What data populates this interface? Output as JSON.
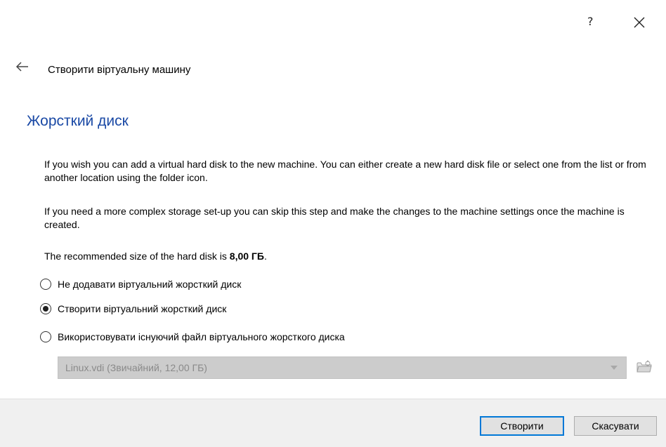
{
  "titlebar": {
    "help_label": "?",
    "close_icon": "close-icon"
  },
  "header": {
    "back_icon": "arrow-left-icon",
    "title": "Створити віртуальну машину"
  },
  "section": {
    "title": "Жорсткий диск"
  },
  "paragraphs": {
    "p1": "If you wish you can add a virtual hard disk to the new machine. You can either create a new hard disk file or select one from the list or from another location using the folder icon.",
    "p2": "If you need a more complex storage set-up you can skip this step and make the changes to the machine settings once the machine is created.",
    "p3_prefix": "The recommended size of the hard disk is ",
    "p3_value": "8,00 ГБ",
    "p3_suffix": "."
  },
  "options": [
    {
      "label": "Не додавати віртуальний жорсткий диск",
      "checked": false
    },
    {
      "label": "Створити віртуальний жорсткий диск",
      "checked": true
    },
    {
      "label": "Використовувати існуючий файл віртуального жорсткого диска",
      "checked": false
    }
  ],
  "disk_select": {
    "value": "Linux.vdi (Звичайний, 12,00 ГБ)",
    "enabled": false
  },
  "buttons": {
    "create": "Створити",
    "cancel": "Скасувати"
  },
  "colors": {
    "section_title": "#1a49a5",
    "default_button_border": "#0078d7",
    "footer_bg": "#f0f0f0"
  }
}
